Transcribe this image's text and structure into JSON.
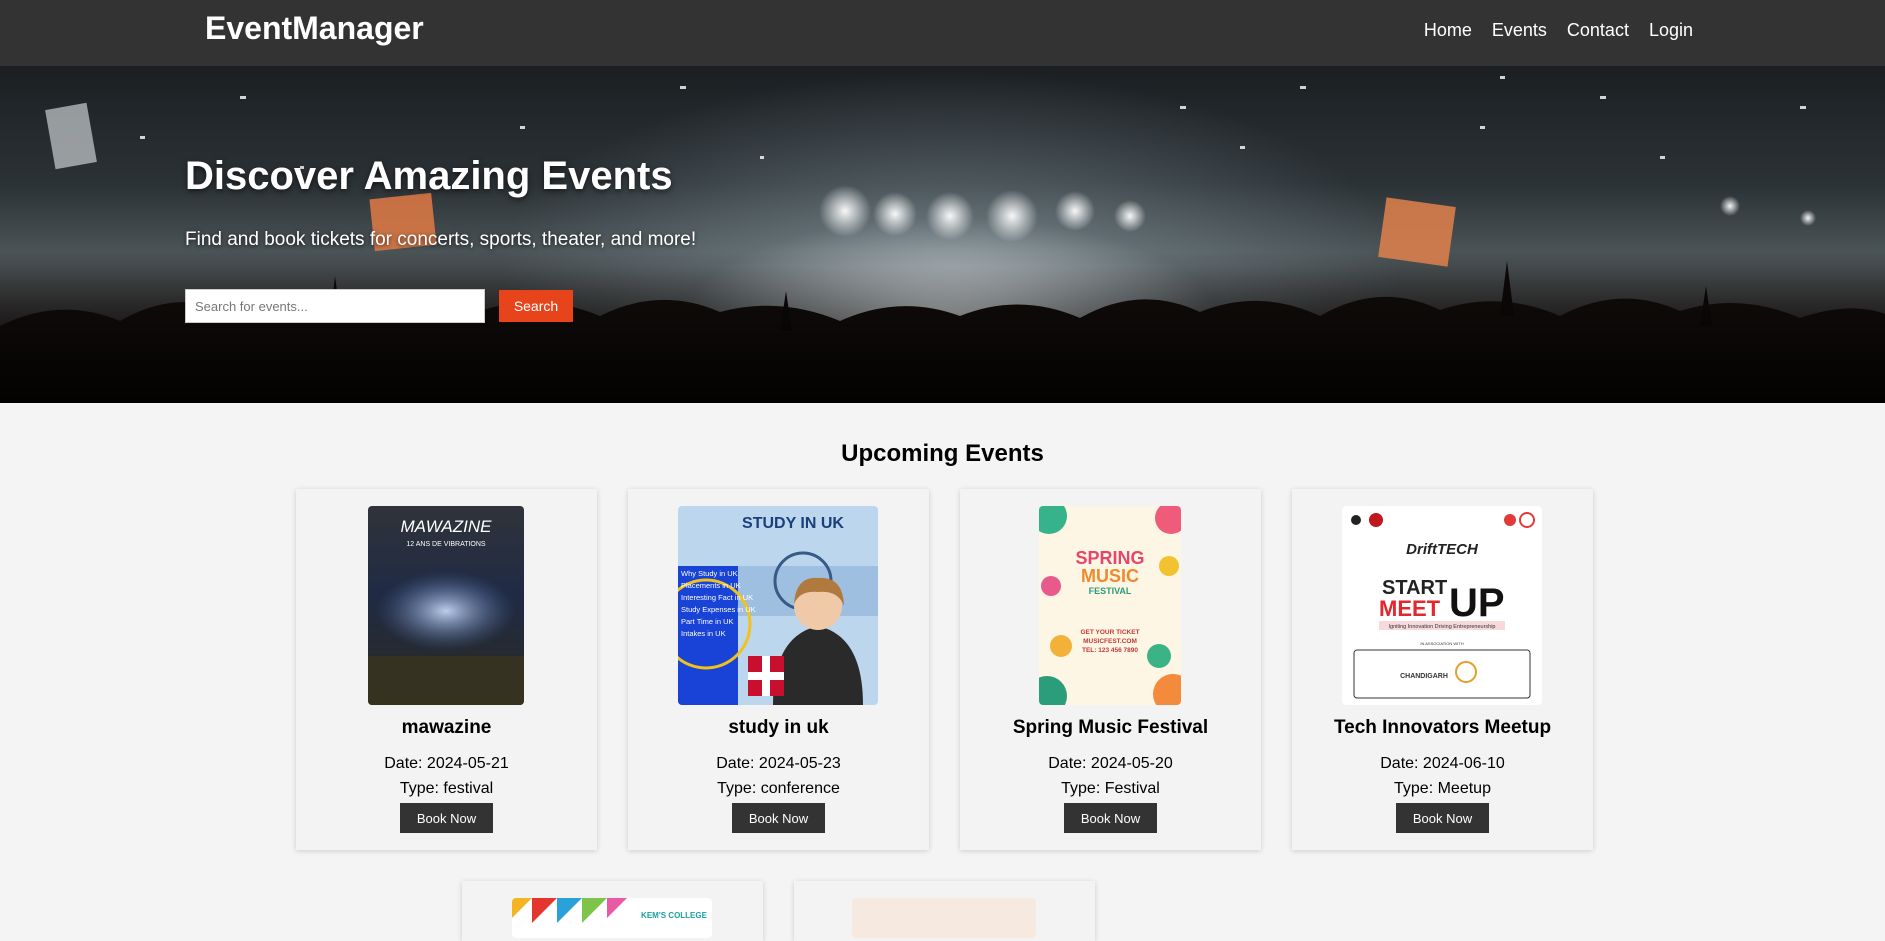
{
  "navbar": {
    "brand": "EventManager",
    "links": [
      {
        "label": "Home"
      },
      {
        "label": "Events"
      },
      {
        "label": "Contact"
      },
      {
        "label": "Login"
      }
    ]
  },
  "hero": {
    "title": "Discover Amazing Events",
    "subtitle": "Find and book tickets for concerts, sports, theater, and more!",
    "search": {
      "placeholder": "Search for events...",
      "value": "",
      "button_label": "Search"
    }
  },
  "events_section": {
    "title": "Upcoming Events",
    "events": [
      {
        "name": "mawazine",
        "date": "Date: 2024-05-21",
        "type": "Type: festival",
        "button_label": "Book Now",
        "poster_text": [
          "MAWAZINE",
          "12 ANS DE VIBRATIONS"
        ]
      },
      {
        "name": "study in uk",
        "date": "Date: 2024-05-23",
        "type": "Type: conference",
        "button_label": "Book Now",
        "poster_text": [
          "STUDY IN UK",
          "Why Study in UK",
          "Placements in UK",
          "Interesting Fact in UK",
          "Study Expenses in UK",
          "Part Time in UK",
          "Intakes in UK"
        ]
      },
      {
        "name": "Spring Music Festival",
        "date": "Date: 2024-05-20",
        "type": "Type: Festival",
        "button_label": "Book Now",
        "poster_text": [
          "SPRING",
          "MUSIC",
          "FESTIVAL",
          "GET YOUR TICKET",
          "MUSICFEST.COM",
          "TEL: 123 456 7890"
        ]
      },
      {
        "name": "Tech Innovators Meetup",
        "date": "Date: 2024-06-10",
        "type": "Type: Meetup",
        "button_label": "Book Now",
        "poster_text": [
          "DriftTECH",
          "START",
          "MEET",
          "UP",
          "Igniting Innovation Driving Entrepreneurship",
          "IN ASSOCIATION WITH",
          "CHANDIGARH"
        ]
      }
    ],
    "partial_cards": [
      {
        "poster_text": [
          "KEM'S COLLEGE"
        ]
      },
      {
        "poster_text": []
      }
    ]
  },
  "colors": {
    "navbar_bg": "#333333",
    "accent": "#e8441c",
    "button_dark": "#333333",
    "page_bg": "#f4f4f4"
  }
}
